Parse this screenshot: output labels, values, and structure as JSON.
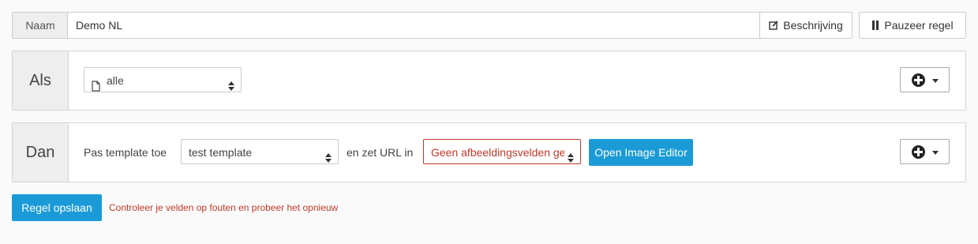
{
  "rule": {
    "name_label": "Naam",
    "name_value": "Demo NL",
    "description_button": "Beschrijving",
    "pause_button": "Pauzeer regel"
  },
  "if_panel": {
    "label": "Als",
    "select_value": "alle",
    "select_icon": "file-icon",
    "add_button_icon": "plus-circle-icon"
  },
  "then_panel": {
    "label": "Dan",
    "apply_text": "Pas template toe",
    "template_select_value": "test template",
    "url_text": "en zet URL in",
    "field_select_value": "Geen afbeeldingsvelden gevonden",
    "open_editor_button": "Open Image Editor",
    "add_button_icon": "plus-circle-icon"
  },
  "footer": {
    "save_button": "Regel opslaan",
    "error_message": "Controleer je velden op fouten en probeer het opnieuw"
  },
  "colors": {
    "primary": "#1a9bd7",
    "error": "#c0392b",
    "panel_label_bg": "#eeeeee"
  }
}
